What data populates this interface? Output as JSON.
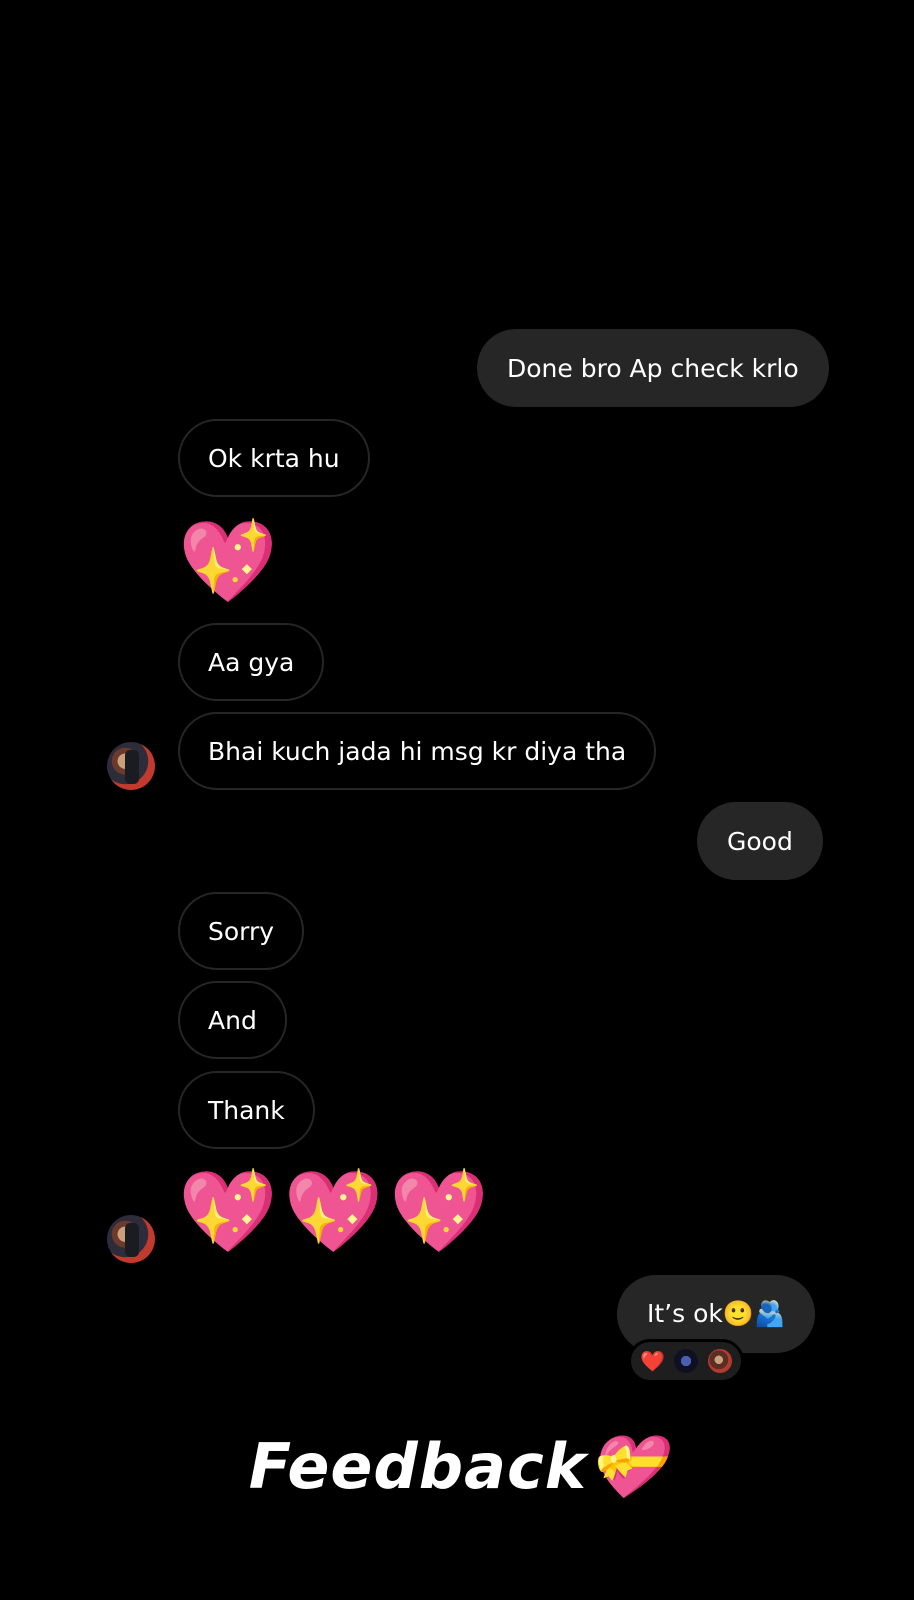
{
  "messages": {
    "m1": "Done bro Ap check krlo",
    "m2": "Ok krta hu",
    "m3": "💖",
    "m4": "Aa gya",
    "m5": "Bhai kuch jada hi msg kr diya tha",
    "m6": "Good",
    "m7": "Sorry",
    "m8": "And",
    "m9": "Thank",
    "m10": "💖💖💖",
    "m11": "It’s ok🙂🫂"
  },
  "reactions": {
    "heart": "❤️"
  },
  "overlay": {
    "caption": "Feedback💝"
  },
  "colors": {
    "background": "#000000",
    "outgoing_bubble": "#262626",
    "incoming_border": "#262626",
    "heart_pink": "#ff2fa8"
  },
  "icons": [
    "sparkling-heart-emoji",
    "avatar",
    "heart-reaction",
    "gift-heart-emoji"
  ]
}
